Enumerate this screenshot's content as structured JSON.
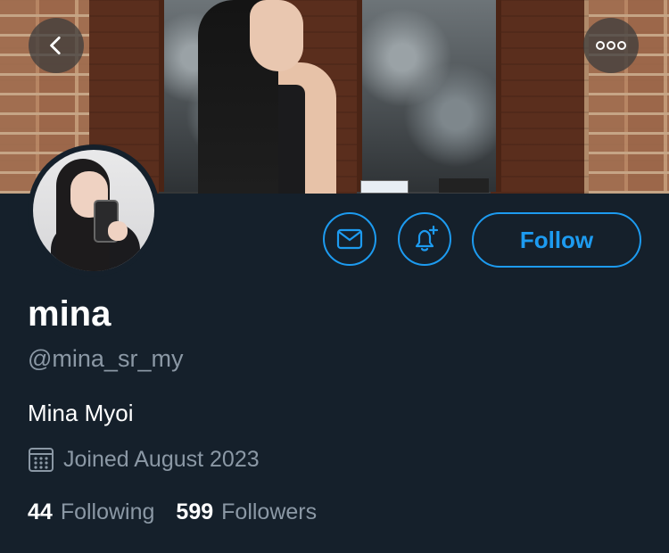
{
  "profile": {
    "display_name": "mina",
    "handle": "@mina_sr_my",
    "bio": "Mina Myoi",
    "joined": "Joined August 2023",
    "following_count": "44",
    "following_label": "Following",
    "followers_count": "599",
    "followers_label": "Followers"
  },
  "actions": {
    "follow_label": "Follow"
  },
  "icons": {
    "back": "chevron-left-icon",
    "more": "more-horizontal-icon",
    "message": "envelope-icon",
    "notify": "bell-plus-icon",
    "calendar": "calendar-icon"
  },
  "colors": {
    "background": "#15202b",
    "accent": "#1d9bf0",
    "secondary_text": "#8b98a5"
  }
}
